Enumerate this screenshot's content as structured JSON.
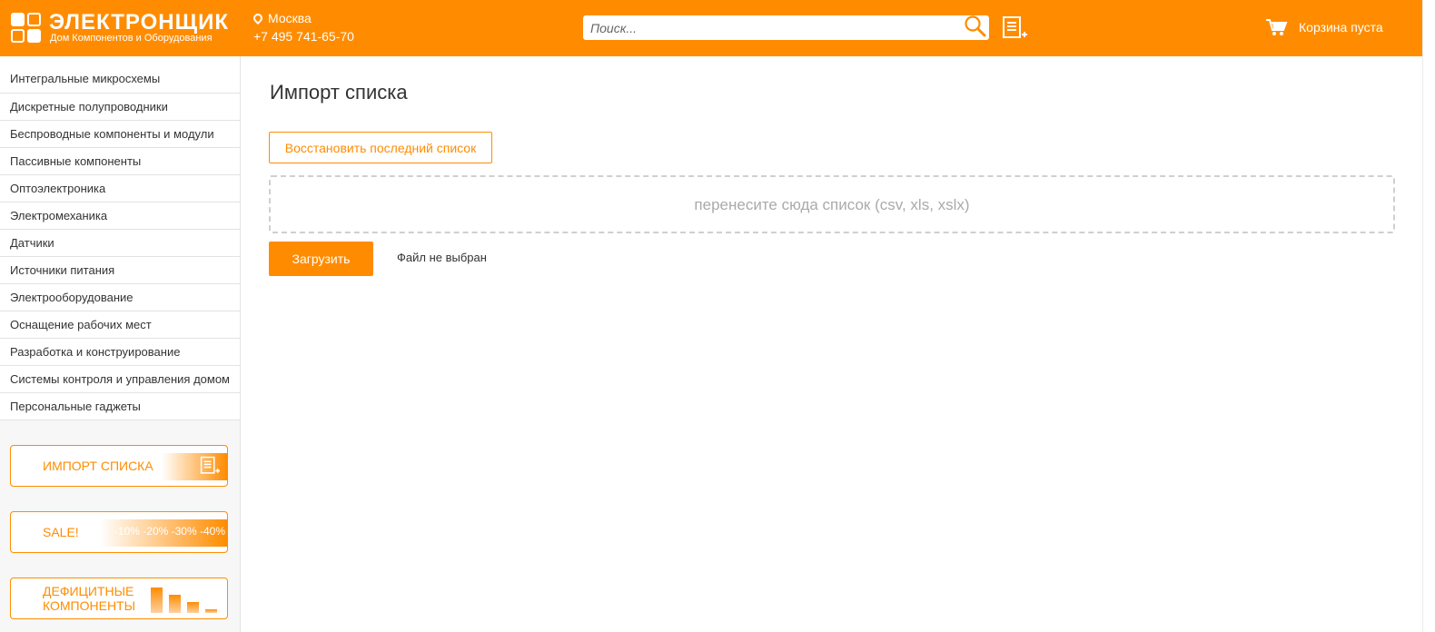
{
  "header": {
    "logo_title": "ЭЛЕКТРОНЩИК",
    "logo_subtitle": "Дом Компонентов и Оборудования",
    "city": "Москва",
    "phone": "+7 495 741-65-70",
    "search_placeholder": "Поиск...",
    "search_value": "",
    "cart_label": "Корзина пуста"
  },
  "sidebar": {
    "categories": [
      "Интегральные микросхемы",
      "Дискретные полупроводники",
      "Беспроводные компоненты и модули",
      "Пассивные компоненты",
      "Оптоэлектроника",
      "Электромеханика",
      "Датчики",
      "Источники питания",
      "Электрооборудование",
      "Оснащение рабочих мест",
      "Разработка и конструирование",
      "Системы контроля и управления домом",
      "Персональные гаджеты"
    ],
    "promos": {
      "import_label": "ИМПОРТ СПИСКА",
      "sale_label": "SALE!",
      "sale_discounts": "-10% -20% -30% -40%",
      "deficit_label_1": "ДЕФИЦИТНЫЕ",
      "deficit_label_2": "КОМПОНЕНТЫ"
    }
  },
  "main": {
    "title": "Импорт списка",
    "restore_button": "Восстановить последний список",
    "dropzone_text": "перенесите сюда список (csv, xls, xslx)",
    "upload_button": "Загрузить",
    "file_status": "Файл не выбран"
  },
  "colors": {
    "accent": "#ff8c00",
    "text": "#333333",
    "muted": "#aaaaaa"
  }
}
